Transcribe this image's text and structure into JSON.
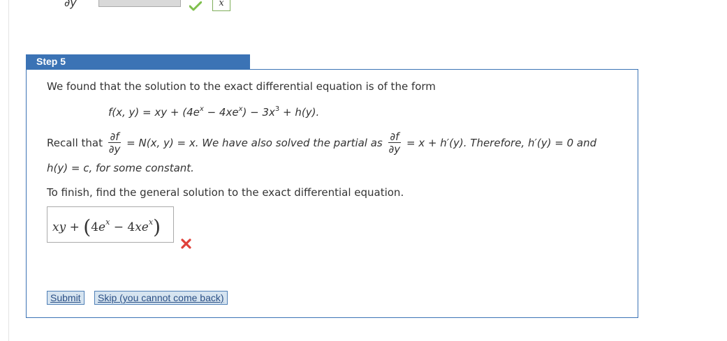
{
  "previous": {
    "dy_label": "∂y",
    "input_value": "",
    "box_label": "x",
    "tick_label": "  "
  },
  "step": {
    "title": "Step 5",
    "intro": "We found that the solution to the exact differential equation is of the form",
    "formula": {
      "lhs": "f(x, y) = xy + (4e",
      "exp1": "x",
      "mid": " − 4xe",
      "exp2": "x",
      "mid2": ") − 3x",
      "exp3": "3",
      "tail": " + h(y)."
    },
    "recall": {
      "prefix": "Recall that ",
      "frac1_num": "∂f",
      "frac1_den": "∂y",
      "middle": " = N(x, y) = x. We have also solved the partial as ",
      "frac2_num": "∂f",
      "frac2_den": "∂y",
      "suffix": " = x + h′(y). Therefore, h′(y) = 0 and",
      "line2": "h(y) = c, for some constant."
    },
    "instruction": "To finish, find the general solution to the exact differential equation.",
    "answer": {
      "part1": "xy + ",
      "lparen": "(",
      "four1": "4",
      "e1": "e",
      "exp1": "x",
      "minus": " − ",
      "four2": "4",
      "xe": "xe",
      "exp2": "x",
      "rparen": ")"
    },
    "submit_label": "Submit",
    "skip_label": "Skip (you cannot come back)"
  },
  "colors": {
    "header_blue": "#3b73b5",
    "correct_green": "#7fbf4d",
    "wrong_red": "#e0413a"
  }
}
